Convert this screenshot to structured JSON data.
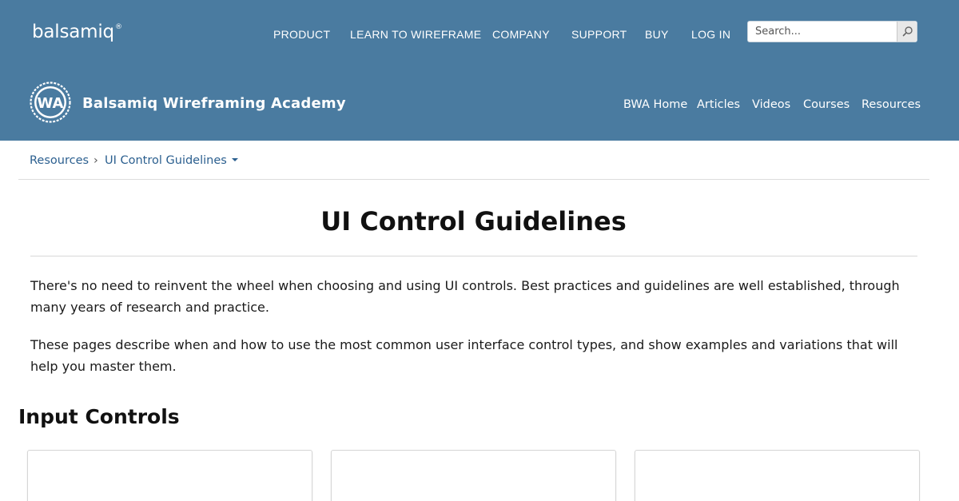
{
  "brand": {
    "name": "balsamiq",
    "reg": "®"
  },
  "topnav": {
    "items": [
      "PRODUCT",
      "LEARN TO WIREFRAME",
      "COMPANY",
      "SUPPORT",
      "BUY",
      "LOG IN"
    ]
  },
  "search": {
    "placeholder": "Search..."
  },
  "academy": {
    "badge": "WA",
    "title": "Balsamiq Wireframing Academy",
    "nav": [
      "BWA Home",
      "Articles",
      "Videos",
      "Courses",
      "Resources"
    ]
  },
  "breadcrumb": {
    "root": "Resources",
    "separator": "›",
    "current": "UI Control Guidelines"
  },
  "main": {
    "title": "UI Control Guidelines",
    "paragraphs": [
      "There's no need to reinvent the wheel when choosing and using UI controls. Best practices and guidelines are well established, through many years of research and practice.",
      "These pages describe when and how to use the most common user interface control types, and show examples and variations that will help you master them."
    ],
    "section_title": "Input Controls"
  },
  "colors": {
    "header_bg": "#4a7ba0",
    "link": "#2b5f8f"
  }
}
